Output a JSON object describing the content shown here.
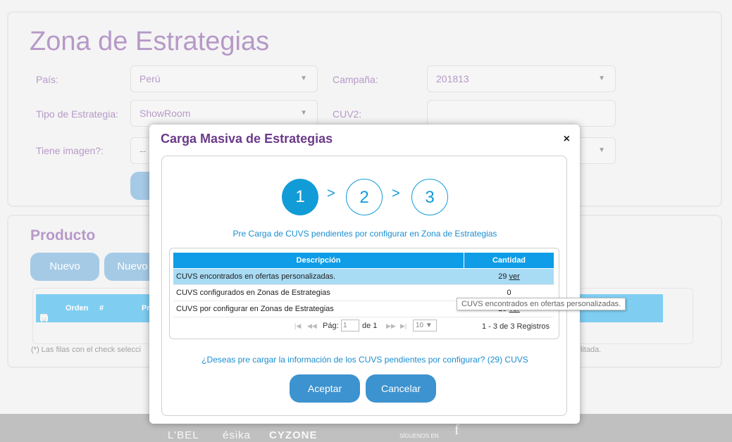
{
  "page": {
    "title": "Zona de Estrategias",
    "filters": {
      "pais_label": "País:",
      "pais_value": "Perú",
      "campania_label": "Campaña:",
      "campania_value": "201813",
      "tipo_label": "Tipo de Estrategia:",
      "tipo_value": "ShowRoom",
      "cuv_label": "CUV2:",
      "cuv_value": "",
      "imagen_label": "Tiene imagen?:",
      "imagen_value": "--"
    }
  },
  "producto": {
    "title": "Producto",
    "nuevo_label": "Nuevo",
    "nuevo2_label": "Nuevo",
    "grid_headers": [
      "(*)",
      "Orden",
      "#",
      "Pre"
    ],
    "footnote": "(*) Las filas con el check selecci",
    "footnote_end": "litada."
  },
  "footer": {
    "brands": [
      "L'BEL",
      "ésika",
      "CYZONE"
    ],
    "follow_label": "SÍGUENOS EN",
    "facebook_glyph": "f"
  },
  "modal": {
    "title": "Carga Masiva de Estrategias",
    "close": "×",
    "steps": [
      "1",
      "2",
      "3"
    ],
    "step_sep": ">",
    "precarga_text": "Pre Carga de CUVS pendientes por configurar en Zona de Estrategias",
    "table": {
      "headers": [
        "Descripción",
        "Cantidad"
      ],
      "rows": [
        {
          "descripcion": "CUVS encontrados en ofertas personalizadas.",
          "cantidad": "29",
          "link": "ver"
        },
        {
          "descripcion": "CUVS configurados en Zonas de Estrategias",
          "cantidad": "0",
          "link": ""
        },
        {
          "descripcion": "CUVS por configurar en Zonas de Estrategias",
          "cantidad": "29",
          "link": "ver"
        }
      ],
      "pager": {
        "pag_label": "Pág:",
        "page_value": "1",
        "de_label": "de 1",
        "page_size": "10",
        "summary": "1 - 3 de 3 Registros"
      }
    },
    "tooltip": "CUVS encontrados en ofertas personalizadas.",
    "question": "¿Deseas pre cargar la información de los CUVS pendientes por configurar? (29) CUVS",
    "accept_label": "Aceptar",
    "cancel_label": "Cancelar"
  }
}
